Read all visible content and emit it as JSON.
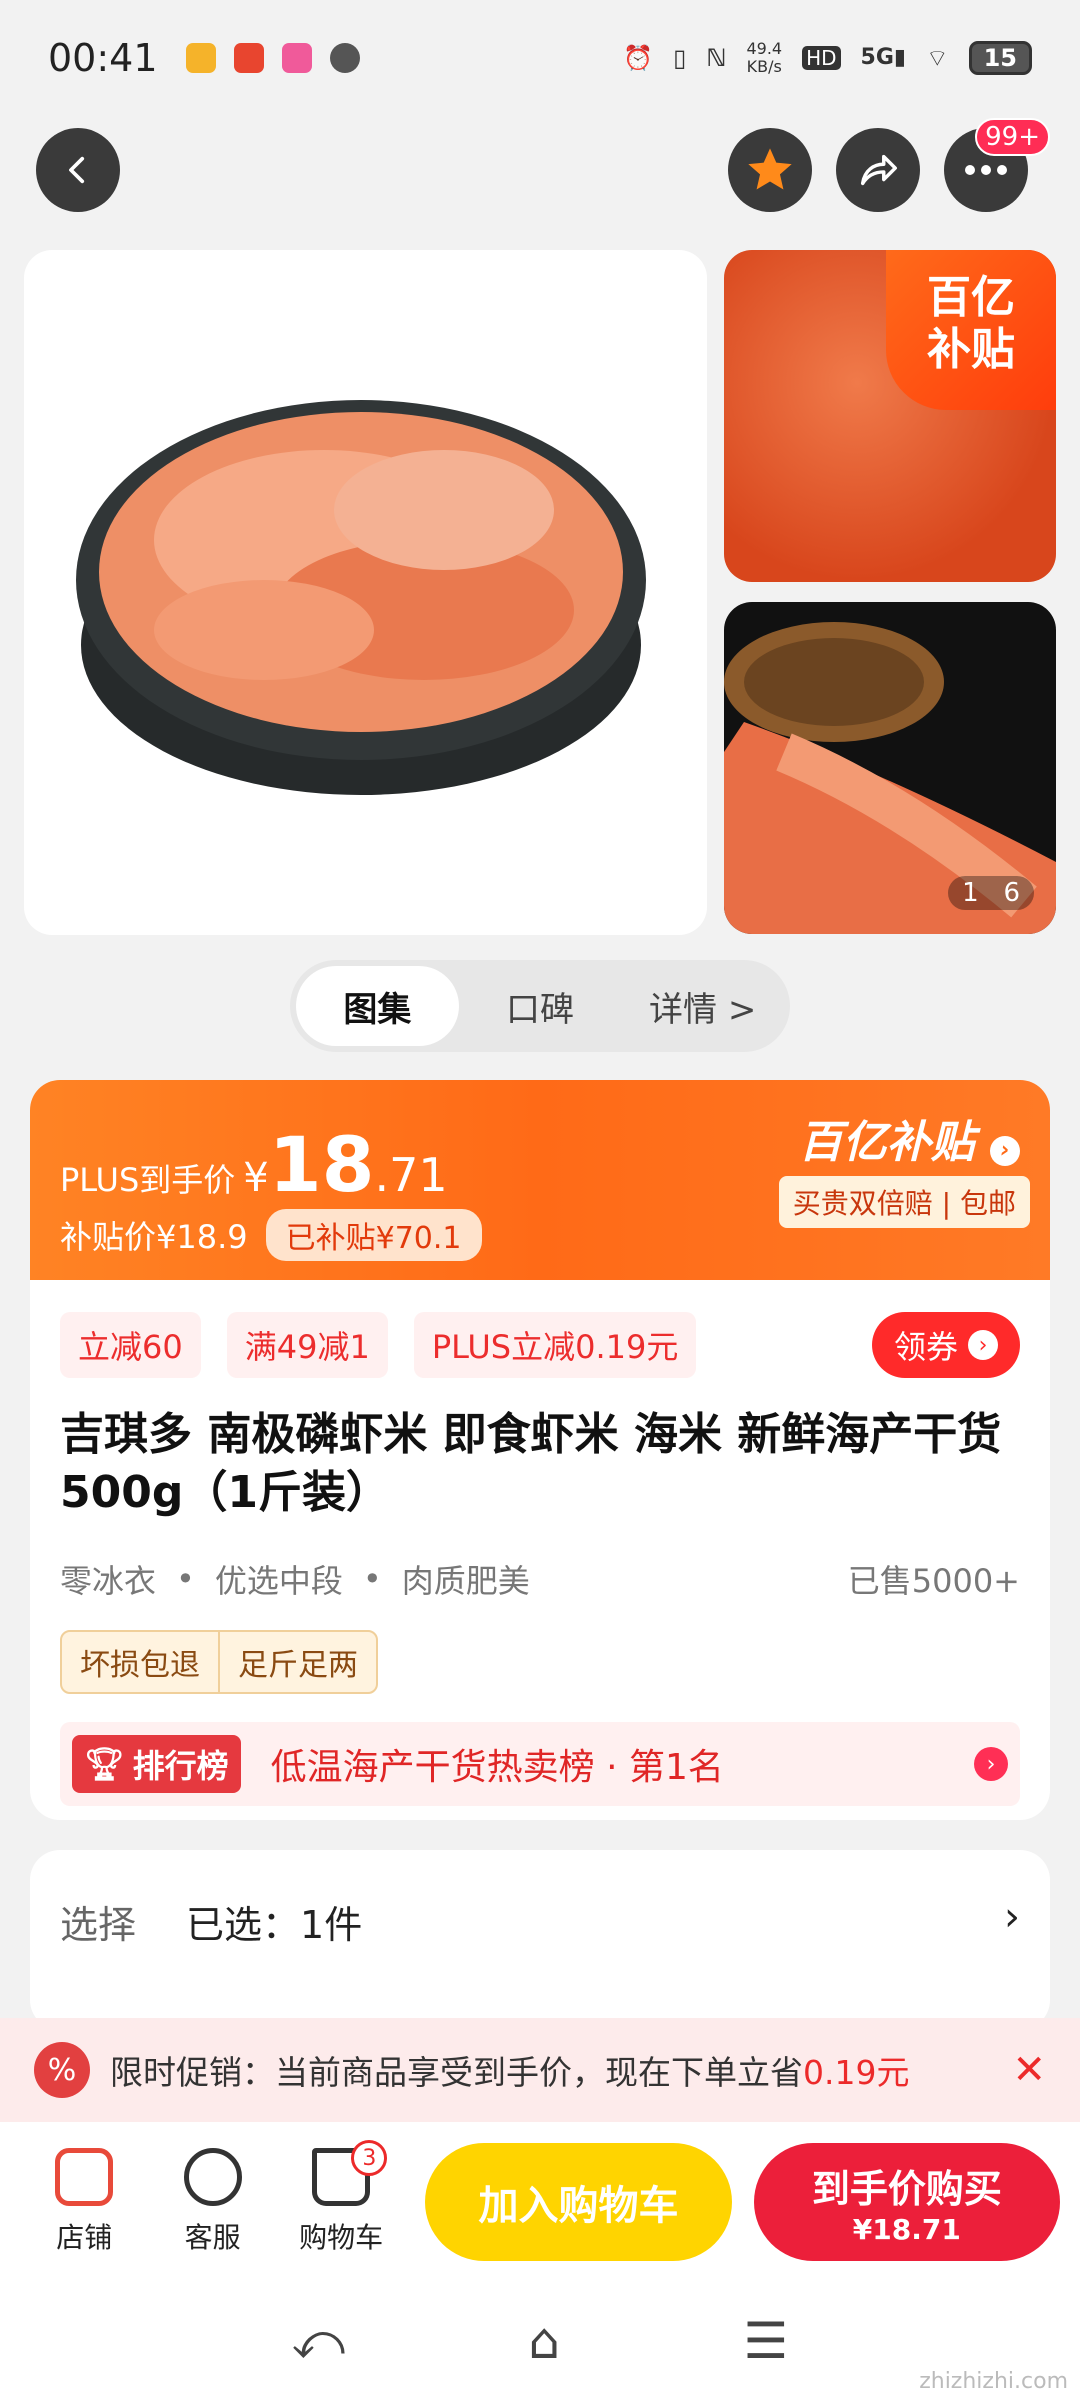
{
  "status_bar": {
    "time": "00:41",
    "net_speed_value": "49.4",
    "net_speed_unit": "KB/s",
    "hd": "HD",
    "signal": "5G",
    "battery": "15"
  },
  "nav": {
    "back_icon": "chevron-left-icon",
    "favorite_icon": "star-icon",
    "share_icon": "share-icon",
    "more_icon": "more-dots-icon",
    "more_badge": "99+"
  },
  "gallery": {
    "subsidy_corner_line1": "百亿",
    "subsidy_corner_line2": "补贴",
    "page_current": "1",
    "page_total": "6"
  },
  "tabs": [
    {
      "label": "图集",
      "active": true
    },
    {
      "label": "口碑",
      "active": false
    },
    {
      "label": "详情 >",
      "active": false
    }
  ],
  "price": {
    "plus_label": "PLUS到手价",
    "currency": "¥",
    "int": "18",
    "dec": ".71",
    "subsidy_price_label": "补贴价¥18.9",
    "subsidized_tag": "已补贴¥70.1",
    "brand": "百亿补贴",
    "brand_badge": "买贵双倍赔 | 包邮"
  },
  "coupons": [
    "立减60",
    "满49减1",
    "PLUS立减0.19元"
  ],
  "get_coupon_label": "领券",
  "product": {
    "title": "吉琪多 南极磷虾米 即食虾米 海米 新鲜海产干货 500g（1斤装）",
    "features": [
      "零冰衣",
      "优选中段",
      "肉质肥美"
    ],
    "sold": "已售5000+",
    "service_tags": [
      "坏损包退",
      "足斤足两"
    ]
  },
  "rank": {
    "pill": "排行榜",
    "text": "低温海产干货热卖榜 · 第1名"
  },
  "select": {
    "label": "选择",
    "value": "已选：1件"
  },
  "promo": {
    "text": "限时促销：当前商品享受到手价，现在下单立省",
    "amount": "0.19元"
  },
  "bottom_bar": {
    "store": "店铺",
    "service": "客服",
    "cart": "购物车",
    "cart_count": "3",
    "add_cart": "加入购物车",
    "buy_line1": "到手价购买",
    "buy_line2": "¥18.71"
  },
  "watermark": "zhizhizhi.com",
  "colors": {
    "accent_orange": "#ff6a17",
    "buy_red": "#ec1f3a",
    "cart_yellow": "#ffd400"
  }
}
